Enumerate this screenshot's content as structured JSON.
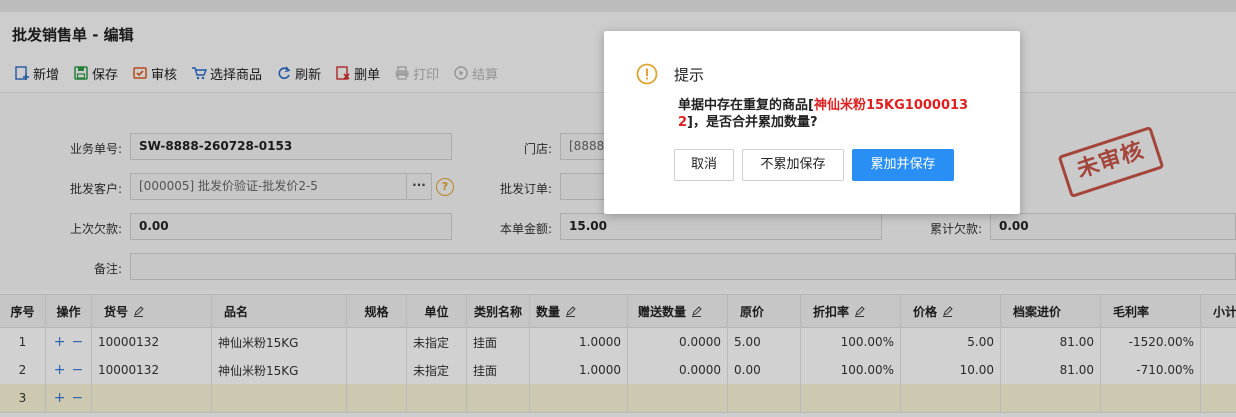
{
  "title": "批发销售单 - 编辑",
  "toolbar": {
    "new": "新增",
    "save": "保存",
    "audit": "审核",
    "select_goods": "选择商品",
    "refresh": "刷新",
    "delete": "删单",
    "print": "打印",
    "finish": "结算"
  },
  "form": {
    "order_no_label": "业务单号:",
    "order_no": "SW-8888-260728-0153",
    "store_label": "门店:",
    "store": "[8888]",
    "customer_label": "批发客户:",
    "customer": "[000005] 批发价验证-批发价2-5",
    "customer_more": "···",
    "help": "?",
    "wholesale_order_label": "批发订单:",
    "last_debt_label": "上次欠款:",
    "last_debt": "0.00",
    "amount_label": "本单金额:",
    "amount": "15.00",
    "total_debt_label": "累计欠款:",
    "total_debt": "0.00",
    "remark_label": "备注:"
  },
  "stamp": "未审核",
  "grid": {
    "headers": [
      "序号",
      "操作",
      "货号",
      "品名",
      "规格",
      "单位",
      "类别名称",
      "数量",
      "赠送数量",
      "原价",
      "折扣率",
      "价格",
      "档案进价",
      "毛利率",
      "小计"
    ],
    "rows": [
      {
        "no": "1",
        "code": "10000132",
        "name": "神仙米粉15KG",
        "spec": "",
        "unit": "未指定",
        "category": "挂面",
        "qty": "1.0000",
        "gift": "0.0000",
        "orig": "5.00",
        "discount": "100.00%",
        "price": "5.00",
        "cost": "81.00",
        "margin": "-1520.00%"
      },
      {
        "no": "2",
        "code": "10000132",
        "name": "神仙米粉15KG",
        "spec": "",
        "unit": "未指定",
        "category": "挂面",
        "qty": "1.0000",
        "gift": "0.0000",
        "orig": "0.00",
        "discount": "100.00%",
        "price": "10.00",
        "cost": "81.00",
        "margin": "-710.00%"
      }
    ],
    "empty_row_no": "3",
    "plus": "+",
    "minus": "−"
  },
  "dialog": {
    "title": "提示",
    "msg_prefix": "单据中存在重复的商品[",
    "msg_goods": "神仙米粉15KG10000132",
    "msg_suffix": "]，是否合并累加数量?",
    "cancel": "取消",
    "no_merge": "不累加保存",
    "merge": "累加并保存"
  },
  "colors": {
    "primary": "#2a8ff5",
    "warning": "#e0a530",
    "danger": "#e02020",
    "stamp": "#c0392b"
  }
}
